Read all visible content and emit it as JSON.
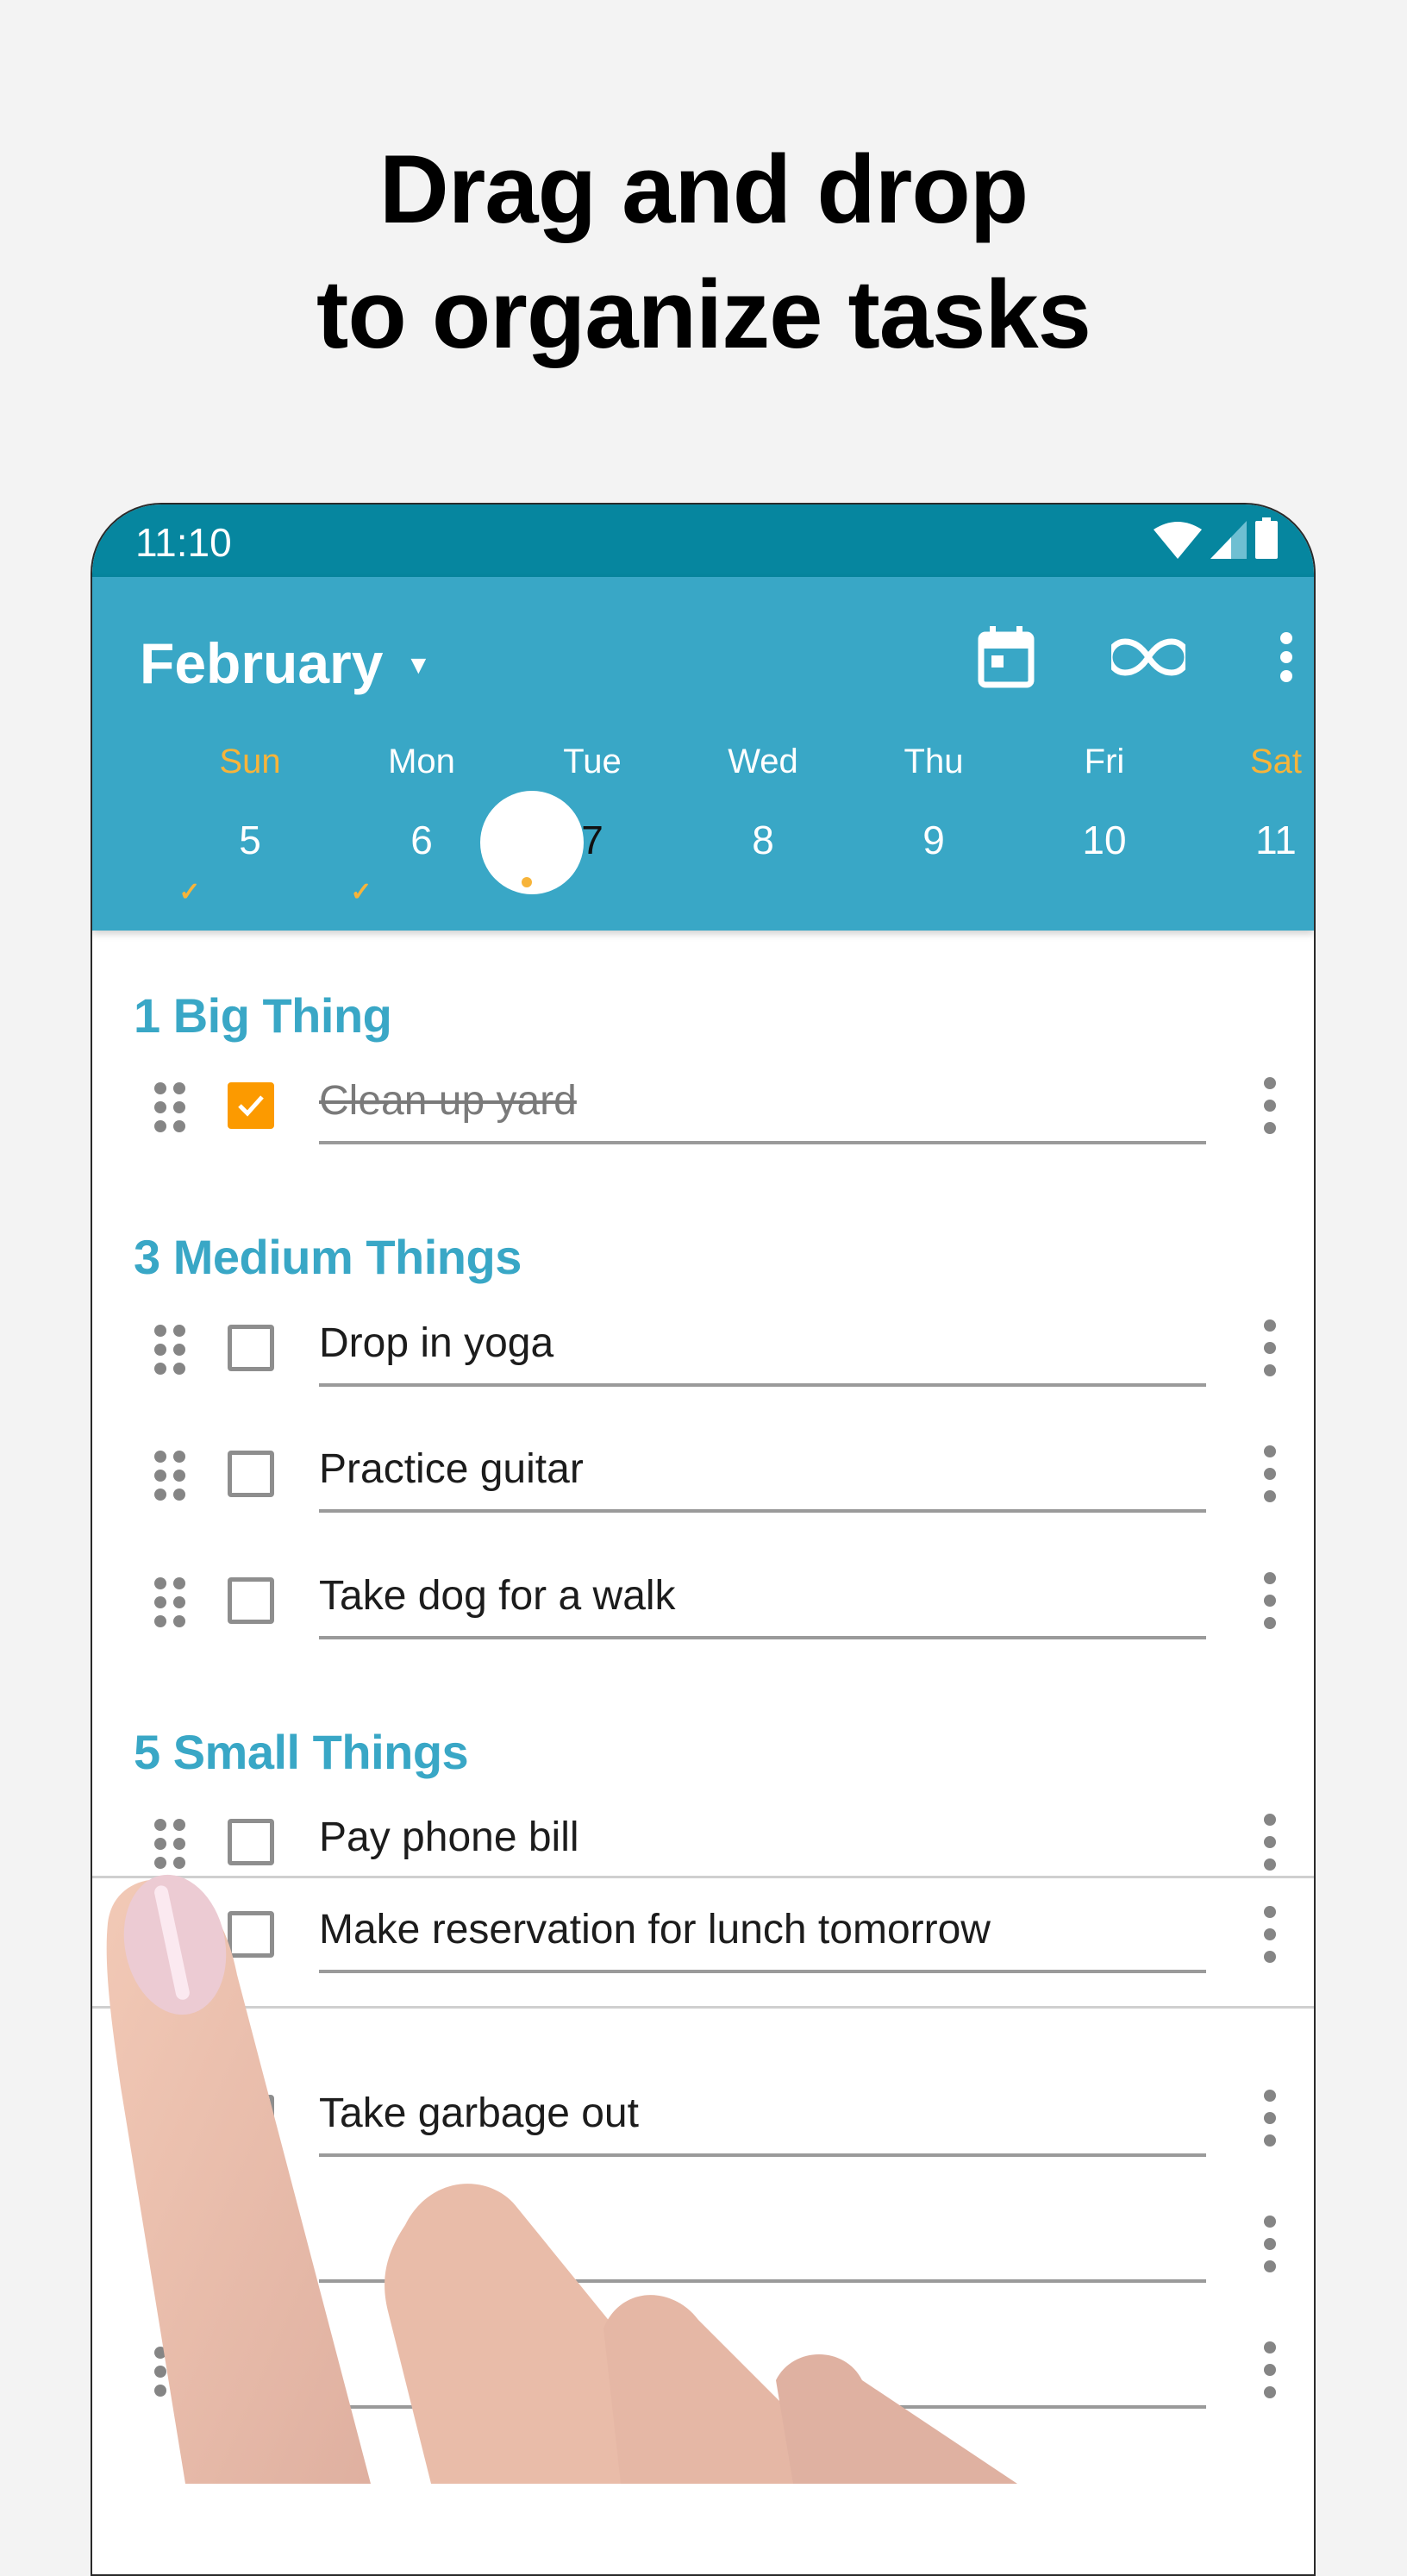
{
  "headline": {
    "line1": "Drag and drop",
    "line2": "to organize tasks"
  },
  "status_bar": {
    "time": "11:10",
    "icons": [
      "wifi-icon",
      "cell-signal-icon",
      "battery-icon"
    ]
  },
  "app_bar": {
    "month": "February",
    "month_caret": "▼",
    "actions": [
      {
        "name": "calendar-icon",
        "label": "Calendar"
      },
      {
        "name": "infinity-icon",
        "label": "Infinity"
      },
      {
        "name": "more-vert-icon",
        "label": "More options"
      }
    ]
  },
  "week": {
    "days": [
      {
        "name": "Sun",
        "num": "5",
        "weekend": true,
        "completed": true,
        "selected": false
      },
      {
        "name": "Mon",
        "num": "6",
        "weekend": false,
        "completed": true,
        "selected": false
      },
      {
        "name": "Tue",
        "num": "7",
        "weekend": false,
        "completed": false,
        "selected": true,
        "has_tasks_dot": true
      },
      {
        "name": "Wed",
        "num": "8",
        "weekend": false,
        "completed": false,
        "selected": false
      },
      {
        "name": "Thu",
        "num": "9",
        "weekend": false,
        "completed": false,
        "selected": false
      },
      {
        "name": "Fri",
        "num": "10",
        "weekend": false,
        "completed": false,
        "selected": false
      },
      {
        "name": "Sat",
        "num": "11",
        "weekend": true,
        "completed": false,
        "selected": false
      }
    ],
    "check_glyph": "✓"
  },
  "sections": [
    {
      "title": "1 Big Thing",
      "tasks": [
        {
          "text": "Clean up yard",
          "done": true
        }
      ]
    },
    {
      "title": "3 Medium Things",
      "tasks": [
        {
          "text": "Drop in yoga",
          "done": false
        },
        {
          "text": "Practice guitar",
          "done": false
        },
        {
          "text": "Take dog for a walk",
          "done": false
        }
      ]
    },
    {
      "title": "5 Small Things",
      "tasks": [
        {
          "text": "Pay phone bill",
          "done": false
        },
        {
          "text": "Make reservation for lunch tomorrow",
          "done": false,
          "dragging": true
        },
        {
          "text": "Take garbage out",
          "done": false
        },
        {
          "text": "",
          "done": false,
          "obscured": true
        },
        {
          "text": "",
          "done": false,
          "obscured": true
        }
      ]
    }
  ],
  "colors": {
    "status_bar": "#06869f",
    "app_bar": "#39a7c6",
    "accent_orange": "#fc9a00",
    "weekend_text": "#f7b43a",
    "section_title": "#39a7c6",
    "background": "#f3f3f3"
  }
}
